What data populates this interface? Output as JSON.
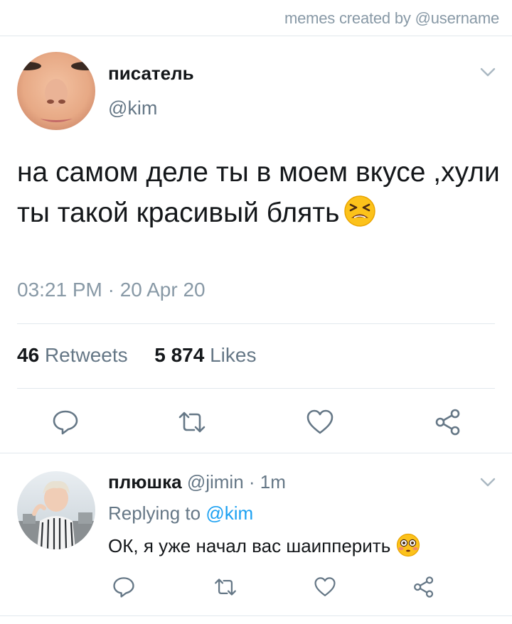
{
  "watermark": "memes created by @username",
  "tweet": {
    "display_name": "писатель",
    "handle": "@kim",
    "text": "на самом деле ты в моем вкусе ,хули ты такой красивый блять",
    "emoji": "tired-face-emoji",
    "timestamp": "03:21 PM · 20 Apr 20",
    "retweets_count": "46",
    "retweets_label": "Retweets",
    "likes_count": "5 874",
    "likes_label": "Likes"
  },
  "reply": {
    "display_name": "плюшка",
    "handle": "@jimin",
    "separator": "·",
    "time": "1m",
    "replying_prefix": "Replying to",
    "replying_to": "@kim",
    "text": "ОК, я уже начал вас шаипперить",
    "emoji": "flushed-face-emoji"
  },
  "icons": [
    "chevron-down-icon",
    "reply-icon",
    "retweet-icon",
    "like-icon",
    "share-icon"
  ],
  "colors": {
    "muted": "#657786",
    "link": "#1da1f2",
    "divider": "#e1e8ed",
    "icon": "#657786"
  }
}
